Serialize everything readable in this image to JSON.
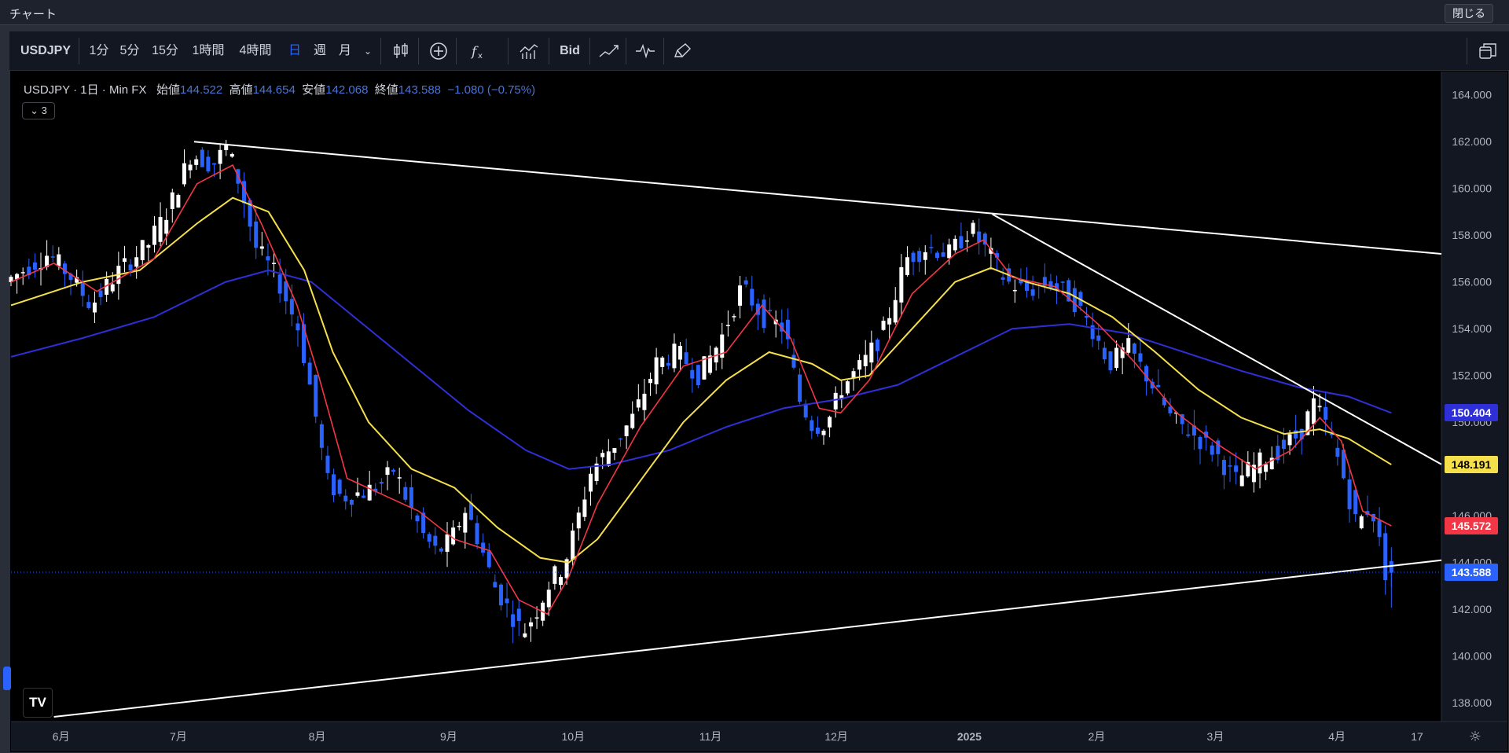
{
  "window": {
    "title": "チャート",
    "close_label": "閉じる"
  },
  "toolbar": {
    "symbol": "USDJPY",
    "intervals": [
      "1分",
      "5分",
      "15分",
      "1時間",
      "4時間",
      "日",
      "週",
      "月"
    ],
    "active_interval": "日",
    "bid_label": "Bid"
  },
  "legend": {
    "symbol": "USDJPY",
    "interval": "1日",
    "source": "Min FX",
    "open_label": "始値",
    "open": "144.522",
    "high_label": "高値",
    "high": "144.654",
    "low_label": "安値",
    "low": "142.068",
    "close_label": "終値",
    "close": "143.588",
    "change": "−1.080 (−0.75%)",
    "collapse_count": "3"
  },
  "colors": {
    "up": "#ffffff",
    "down": "#2962ff",
    "ma_short": "#f23645",
    "ma_mid": "#f5e04b",
    "ma_long": "#2f2fd8",
    "trendline": "#ffffff",
    "background": "#000000"
  },
  "price_tags": [
    {
      "value": "150.404",
      "color": "#2f2fd8",
      "text_color": "#ffffff"
    },
    {
      "value": "148.191",
      "color": "#f5e04b",
      "text_color": "#000000"
    },
    {
      "value": "145.572",
      "color": "#f23645",
      "text_color": "#ffffff"
    },
    {
      "value": "143.588",
      "color": "#2962ff",
      "text_color": "#ffffff"
    }
  ],
  "chart_data": {
    "type": "candlestick",
    "title": "USDJPY · 1日 · Min FX",
    "ylim": [
      137.2,
      165.0
    ],
    "y_ticks": [
      "164.000",
      "162.000",
      "160.000",
      "158.000",
      "156.000",
      "154.000",
      "152.000",
      "150.000",
      "148.000",
      "146.000",
      "144.000",
      "142.000",
      "140.000",
      "138.000"
    ],
    "x_ticks": [
      {
        "label": "6月",
        "x": 0.035
      },
      {
        "label": "7月",
        "x": 0.117
      },
      {
        "label": "8月",
        "x": 0.214
      },
      {
        "label": "9月",
        "x": 0.306
      },
      {
        "label": "10月",
        "x": 0.393
      },
      {
        "label": "11月",
        "x": 0.489
      },
      {
        "label": "12月",
        "x": 0.577
      },
      {
        "label": "2025",
        "x": 0.67
      },
      {
        "label": "2月",
        "x": 0.759
      },
      {
        "label": "3月",
        "x": 0.842
      },
      {
        "label": "4月",
        "x": 0.927
      },
      {
        "label": "17",
        "x": 0.983
      }
    ],
    "price_path": [
      [
        0.0,
        156.0
      ],
      [
        0.03,
        157.2
      ],
      [
        0.045,
        156.3
      ],
      [
        0.06,
        155.0
      ],
      [
        0.08,
        156.5
      ],
      [
        0.1,
        157.6
      ],
      [
        0.115,
        159.2
      ],
      [
        0.13,
        161.5
      ],
      [
        0.145,
        161.0
      ],
      [
        0.155,
        161.8
      ],
      [
        0.165,
        160.0
      ],
      [
        0.175,
        157.5
      ],
      [
        0.19,
        156.2
      ],
      [
        0.205,
        154.0
      ],
      [
        0.215,
        151.0
      ],
      [
        0.225,
        147.5
      ],
      [
        0.235,
        146.8
      ],
      [
        0.25,
        147.0
      ],
      [
        0.262,
        147.3
      ],
      [
        0.272,
        148.0
      ],
      [
        0.282,
        146.5
      ],
      [
        0.292,
        145.2
      ],
      [
        0.302,
        144.4
      ],
      [
        0.312,
        145.0
      ],
      [
        0.322,
        146.3
      ],
      [
        0.332,
        144.8
      ],
      [
        0.342,
        143.0
      ],
      [
        0.352,
        142.0
      ],
      [
        0.362,
        141.0
      ],
      [
        0.372,
        142.0
      ],
      [
        0.382,
        143.3
      ],
      [
        0.39,
        143.8
      ],
      [
        0.398,
        145.3
      ],
      [
        0.41,
        148.0
      ],
      [
        0.425,
        149.0
      ],
      [
        0.44,
        150.3
      ],
      [
        0.455,
        152.5
      ],
      [
        0.47,
        153.0
      ],
      [
        0.485,
        152.0
      ],
      [
        0.5,
        153.5
      ],
      [
        0.515,
        155.8
      ],
      [
        0.53,
        154.5
      ],
      [
        0.545,
        154.0
      ],
      [
        0.555,
        151.0
      ],
      [
        0.565,
        149.8
      ],
      [
        0.575,
        150.0
      ],
      [
        0.585,
        151.5
      ],
      [
        0.6,
        152.5
      ],
      [
        0.615,
        154.0
      ],
      [
        0.63,
        157.0
      ],
      [
        0.645,
        157.5
      ],
      [
        0.66,
        157.2
      ],
      [
        0.675,
        158.3
      ],
      [
        0.69,
        157.0
      ],
      [
        0.7,
        156.0
      ],
      [
        0.715,
        155.6
      ],
      [
        0.73,
        156.0
      ],
      [
        0.745,
        155.4
      ],
      [
        0.76,
        154.0
      ],
      [
        0.772,
        152.5
      ],
      [
        0.785,
        153.2
      ],
      [
        0.8,
        151.8
      ],
      [
        0.815,
        150.2
      ],
      [
        0.83,
        149.5
      ],
      [
        0.845,
        148.8
      ],
      [
        0.86,
        147.5
      ],
      [
        0.875,
        148.2
      ],
      [
        0.89,
        148.8
      ],
      [
        0.905,
        149.5
      ],
      [
        0.915,
        150.8
      ],
      [
        0.925,
        149.7
      ],
      [
        0.935,
        147.8
      ],
      [
        0.945,
        145.6
      ],
      [
        0.955,
        146.5
      ],
      [
        0.965,
        143.6
      ]
    ],
    "ma_short_path": [
      [
        0.0,
        156.0
      ],
      [
        0.03,
        156.8
      ],
      [
        0.06,
        155.6
      ],
      [
        0.1,
        157.0
      ],
      [
        0.13,
        160.2
      ],
      [
        0.155,
        161.0
      ],
      [
        0.175,
        158.5
      ],
      [
        0.2,
        155.0
      ],
      [
        0.215,
        152.0
      ],
      [
        0.235,
        147.6
      ],
      [
        0.26,
        146.9
      ],
      [
        0.285,
        146.2
      ],
      [
        0.31,
        145.0
      ],
      [
        0.335,
        144.5
      ],
      [
        0.355,
        142.4
      ],
      [
        0.375,
        141.8
      ],
      [
        0.39,
        143.4
      ],
      [
        0.41,
        146.5
      ],
      [
        0.44,
        149.8
      ],
      [
        0.47,
        152.4
      ],
      [
        0.5,
        153.0
      ],
      [
        0.525,
        155.0
      ],
      [
        0.545,
        153.6
      ],
      [
        0.565,
        150.6
      ],
      [
        0.58,
        150.4
      ],
      [
        0.6,
        151.8
      ],
      [
        0.63,
        155.5
      ],
      [
        0.66,
        157.2
      ],
      [
        0.68,
        157.8
      ],
      [
        0.7,
        156.2
      ],
      [
        0.73,
        155.8
      ],
      [
        0.76,
        154.2
      ],
      [
        0.785,
        152.6
      ],
      [
        0.815,
        150.4
      ],
      [
        0.845,
        149.0
      ],
      [
        0.87,
        148.0
      ],
      [
        0.895,
        148.8
      ],
      [
        0.915,
        150.2
      ],
      [
        0.93,
        149.2
      ],
      [
        0.945,
        146.2
      ],
      [
        0.965,
        145.57
      ]
    ],
    "ma_mid_path": [
      [
        0.0,
        155.0
      ],
      [
        0.05,
        156.0
      ],
      [
        0.09,
        156.5
      ],
      [
        0.13,
        158.5
      ],
      [
        0.155,
        159.6
      ],
      [
        0.18,
        159.0
      ],
      [
        0.205,
        156.5
      ],
      [
        0.225,
        153.0
      ],
      [
        0.25,
        150.0
      ],
      [
        0.28,
        148.0
      ],
      [
        0.31,
        147.2
      ],
      [
        0.34,
        145.5
      ],
      [
        0.37,
        144.2
      ],
      [
        0.39,
        144.0
      ],
      [
        0.41,
        145.0
      ],
      [
        0.44,
        147.5
      ],
      [
        0.47,
        150.0
      ],
      [
        0.5,
        151.8
      ],
      [
        0.53,
        153.0
      ],
      [
        0.56,
        152.5
      ],
      [
        0.58,
        151.8
      ],
      [
        0.6,
        152.0
      ],
      [
        0.63,
        154.0
      ],
      [
        0.66,
        156.0
      ],
      [
        0.685,
        156.6
      ],
      [
        0.71,
        156.0
      ],
      [
        0.74,
        155.5
      ],
      [
        0.77,
        154.5
      ],
      [
        0.8,
        153.0
      ],
      [
        0.83,
        151.4
      ],
      [
        0.86,
        150.2
      ],
      [
        0.89,
        149.5
      ],
      [
        0.915,
        149.7
      ],
      [
        0.935,
        149.3
      ],
      [
        0.965,
        148.19
      ]
    ],
    "ma_long_path": [
      [
        0.0,
        152.8
      ],
      [
        0.05,
        153.6
      ],
      [
        0.1,
        154.5
      ],
      [
        0.15,
        156.0
      ],
      [
        0.18,
        156.5
      ],
      [
        0.21,
        156.0
      ],
      [
        0.24,
        154.5
      ],
      [
        0.28,
        152.5
      ],
      [
        0.32,
        150.5
      ],
      [
        0.36,
        148.8
      ],
      [
        0.39,
        148.0
      ],
      [
        0.42,
        148.2
      ],
      [
        0.46,
        148.8
      ],
      [
        0.5,
        149.8
      ],
      [
        0.54,
        150.6
      ],
      [
        0.58,
        151.0
      ],
      [
        0.62,
        151.6
      ],
      [
        0.66,
        152.8
      ],
      [
        0.7,
        154.0
      ],
      [
        0.74,
        154.2
      ],
      [
        0.78,
        153.8
      ],
      [
        0.82,
        153.0
      ],
      [
        0.86,
        152.2
      ],
      [
        0.9,
        151.5
      ],
      [
        0.935,
        151.1
      ],
      [
        0.965,
        150.4
      ]
    ],
    "trendlines": [
      {
        "from": [
          0.128,
          162.0
        ],
        "to": [
          1.0,
          157.2
        ]
      },
      {
        "from": [
          0.686,
          158.9
        ],
        "to": [
          1.0,
          148.2
        ]
      },
      {
        "from": [
          0.03,
          137.4
        ],
        "to": [
          1.0,
          144.1
        ]
      }
    ],
    "current_price": 143.588
  }
}
